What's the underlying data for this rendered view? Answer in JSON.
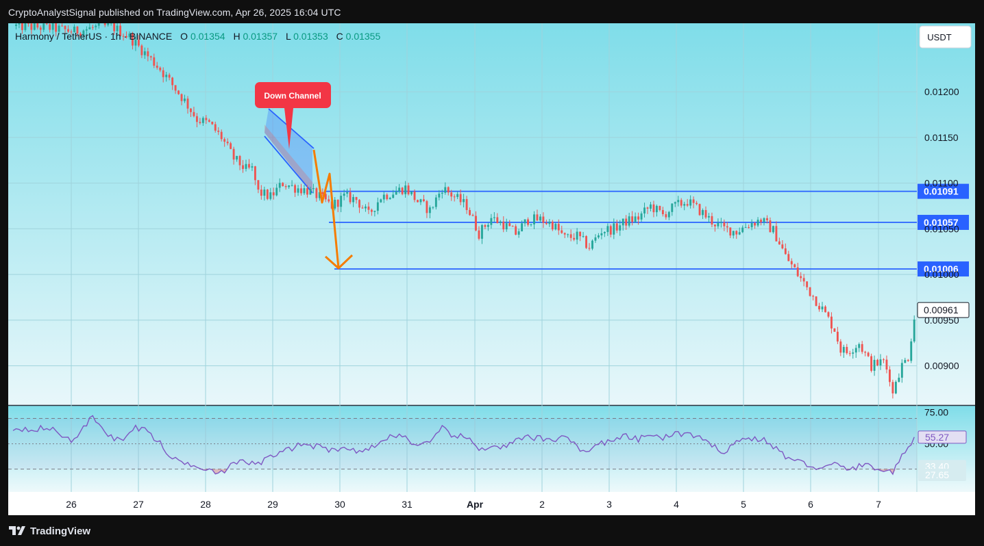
{
  "header": {
    "published_text": "CryptoAnalystSignal published on TradingView.com, Apr 26, 2025 16:04 UTC"
  },
  "symbol_bar": {
    "pair": "Harmony / TetherUS · 1h · BINANCE",
    "open_label": "O",
    "open": "0.01354",
    "high_label": "H",
    "high": "0.01357",
    "low_label": "L",
    "low": "0.01353",
    "close_label": "C",
    "close": "0.01355"
  },
  "currency_button": {
    "label": "USDT"
  },
  "annotation": {
    "text": "Down Channel"
  },
  "footer": {
    "brand": "TradingView",
    "logo_icon": "tradingview-logo-icon"
  },
  "colors": {
    "up": "#26a69a",
    "down": "#ef5350",
    "level": "#2962ff",
    "rsi": "#7e57c2",
    "arrow": "#f57c00",
    "callout": "#f23645",
    "bg_top": "#7fdde9",
    "bg_bottom": "#e8f7fa"
  },
  "chart_data": [
    {
      "type": "candlestick",
      "title": "Harmony / TetherUS · 1h · BINANCE",
      "x_ticks": [
        "26",
        "27",
        "28",
        "29",
        "30",
        "31",
        "Apr",
        "2",
        "3",
        "4",
        "5",
        "6",
        "7"
      ],
      "y_ticks": [
        "0.00900",
        "0.00950",
        "0.01000",
        "0.01050",
        "0.01100",
        "0.01150",
        "0.01200"
      ],
      "ylim": [
        0.00857,
        0.01275
      ],
      "horizontal_levels": [
        {
          "label": "0.01091",
          "value": 0.01091
        },
        {
          "label": "0.01057",
          "value": 0.01057
        },
        {
          "label": "0.01006",
          "value": 0.01006
        }
      ],
      "last_price": {
        "label": "0.00961",
        "value": 0.00961
      },
      "price_path": [
        [
          0,
          0.01272
        ],
        [
          3,
          0.0127
        ],
        [
          5,
          0.01266
        ],
        [
          6.5,
          0.0127
        ],
        [
          8,
          0.01272
        ],
        [
          9.5,
          0.0126
        ],
        [
          12,
          0.01225
        ],
        [
          14,
          0.0119
        ],
        [
          15,
          0.0117
        ],
        [
          16,
          0.01165
        ],
        [
          17,
          0.0115
        ],
        [
          18,
          0.01127
        ],
        [
          19,
          0.01115
        ],
        [
          19.5,
          0.01115
        ],
        [
          20,
          0.0109
        ],
        [
          21,
          0.01085
        ],
        [
          22,
          0.011
        ],
        [
          23,
          0.01095
        ],
        [
          24,
          0.01092
        ],
        [
          25,
          0.01085
        ],
        [
          26,
          0.01075
        ],
        [
          27,
          0.01085
        ],
        [
          28,
          0.01082
        ],
        [
          29,
          0.01065
        ],
        [
          30,
          0.01085
        ],
        [
          31,
          0.0109
        ],
        [
          32,
          0.01095
        ],
        [
          33,
          0.0108
        ],
        [
          34,
          0.0107
        ],
        [
          35,
          0.01095
        ],
        [
          36,
          0.01085
        ],
        [
          37,
          0.01075
        ],
        [
          38,
          0.01045
        ],
        [
          39,
          0.01062
        ],
        [
          40,
          0.01055
        ],
        [
          41,
          0.01045
        ],
        [
          42,
          0.0106
        ],
        [
          43,
          0.0106
        ],
        [
          44,
          0.01055
        ],
        [
          45,
          0.0104
        ],
        [
          46,
          0.01042
        ],
        [
          47,
          0.0103
        ],
        [
          48,
          0.01048
        ],
        [
          49,
          0.0105
        ],
        [
          50,
          0.01058
        ],
        [
          51,
          0.01062
        ],
        [
          52,
          0.01075
        ],
        [
          53,
          0.01065
        ],
        [
          54,
          0.01075
        ],
        [
          55,
          0.0108
        ],
        [
          56,
          0.0107
        ],
        [
          57,
          0.01058
        ],
        [
          58,
          0.0105
        ],
        [
          59,
          0.01047
        ],
        [
          60,
          0.01055
        ],
        [
          61,
          0.0106
        ],
        [
          62,
          0.01048
        ],
        [
          62.5,
          0.01035
        ],
        [
          63,
          0.0102
        ],
        [
          64,
          0.01
        ],
        [
          66,
          0.00962
        ],
        [
          67,
          0.0094
        ],
        [
          67.5,
          0.00918
        ],
        [
          68,
          0.00915
        ],
        [
          69,
          0.00925
        ],
        [
          70,
          0.009
        ],
        [
          71,
          0.00905
        ],
        [
          71.5,
          0.00888
        ],
        [
          71.8,
          0.00865
        ],
        [
          72,
          0.00885
        ],
        [
          72.5,
          0.009
        ],
        [
          73,
          0.0091
        ],
        [
          73.6,
          0.00961
        ]
      ],
      "price_noise": 0.00012
    },
    {
      "type": "line",
      "title": "RSI",
      "y_ticks": [
        "75.00",
        "50.00"
      ],
      "value_labels": [
        "55.27",
        "33.40",
        "27.65"
      ],
      "ylim": [
        12,
        80
      ],
      "bands": [
        70,
        50,
        30
      ],
      "rsi_path": [
        [
          0,
          62
        ],
        [
          3,
          62
        ],
        [
          5,
          52
        ],
        [
          6.5,
          72
        ],
        [
          8,
          55
        ],
        [
          9,
          53
        ],
        [
          10,
          63
        ],
        [
          11,
          60
        ],
        [
          12,
          50
        ],
        [
          13,
          38
        ],
        [
          14,
          35
        ],
        [
          15,
          33
        ],
        [
          16,
          30
        ],
        [
          17,
          27
        ],
        [
          18,
          34
        ],
        [
          19,
          36
        ],
        [
          20,
          34
        ],
        [
          21,
          40
        ],
        [
          22,
          43
        ],
        [
          23,
          48
        ],
        [
          24,
          50
        ],
        [
          25,
          47
        ],
        [
          26,
          45
        ],
        [
          27,
          48
        ],
        [
          28,
          43
        ],
        [
          29,
          47
        ],
        [
          30,
          50
        ],
        [
          31,
          58
        ],
        [
          32,
          55
        ],
        [
          33,
          48
        ],
        [
          34,
          50
        ],
        [
          35,
          62
        ],
        [
          36,
          56
        ],
        [
          37,
          55
        ],
        [
          38,
          45
        ],
        [
          39,
          49
        ],
        [
          40,
          47
        ],
        [
          41,
          52
        ],
        [
          42,
          55
        ],
        [
          43,
          54
        ],
        [
          44,
          52
        ],
        [
          45,
          58
        ],
        [
          46,
          47
        ],
        [
          47,
          44
        ],
        [
          48,
          51
        ],
        [
          49,
          52
        ],
        [
          50,
          56
        ],
        [
          51,
          53
        ],
        [
          52,
          58
        ],
        [
          53,
          54
        ],
        [
          54,
          58
        ],
        [
          55,
          58
        ],
        [
          56,
          54
        ],
        [
          57,
          48
        ],
        [
          58,
          44
        ],
        [
          59,
          52
        ],
        [
          60,
          54
        ],
        [
          61,
          54
        ],
        [
          62,
          48
        ],
        [
          63,
          40
        ],
        [
          64,
          36
        ],
        [
          65,
          33
        ],
        [
          66,
          30
        ],
        [
          67,
          34
        ],
        [
          68,
          30
        ],
        [
          69,
          32
        ],
        [
          70,
          33
        ],
        [
          71,
          28
        ],
        [
          71.8,
          27.65
        ],
        [
          72,
          34
        ],
        [
          73,
          45
        ],
        [
          73.6,
          55.27
        ]
      ],
      "rsi_noise": 5
    }
  ]
}
